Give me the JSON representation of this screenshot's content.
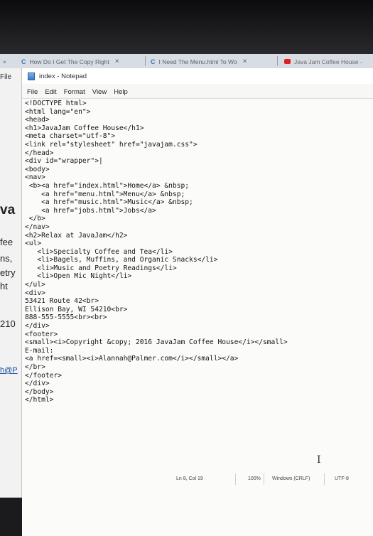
{
  "browser": {
    "tabs": [
      {
        "label": "How Do I Get The Copy Right"
      },
      {
        "label": "I Need The Menu.html To Wo"
      },
      {
        "label": "Java Jam Coffee House -"
      }
    ],
    "tab_close": "×",
    "tab_x_left": "×"
  },
  "background_page": {
    "file_label": "File",
    "fragments": [
      "va",
      "fee",
      "ns,",
      "etry",
      "ht",
      "210",
      "h@P"
    ]
  },
  "notepad": {
    "title": "index - Notepad",
    "menu": [
      "File",
      "Edit",
      "Format",
      "View",
      "Help"
    ],
    "lines": [
      "<!DOCTYPE html>",
      "<html lang=\"en\">",
      "<head>",
      "<h1>JavaJam Coffee House</h1>",
      "<meta charset=\"utf-8\">",
      "<link rel=\"stylesheet\" href=\"javajam.css\">",
      "</head>",
      "<div id=\"wrapper\">|",
      "<body>",
      "<nav>",
      " <b><a href=\"index.html\">Home</a> &nbsp;",
      "    <a href=\"menu.html\">Menu</a> &nbsp;",
      "    <a href=\"music.html\">Music</a> &nbsp;",
      "    <a href=\"jobs.html\">Jobs</a>",
      " </b>",
      "</nav>",
      "<h2>Relax at JavaJam</h2>",
      "<ul>",
      "   <li>Specialty Coffee and Tea</li>",
      "   <li>Bagels, Muffins, and Organic Snacks</li>",
      "   <li>Music and Poetry Readings</li>",
      "   <li>Open Mic Night</li>",
      "</ul>",
      "<div>",
      "53421 Route 42<br>",
      "Ellison Bay, WI 54210<br>",
      "888-555-5555<br><br>",
      "</div>",
      "<footer>",
      "<small><i>Copyright &copy; 2016 JavaJam Coffee House</i></small>",
      "E-mail:",
      "<a href=<small><i>Alannah@Palmer.com</i></small></a>",
      "</br>",
      "</footer>",
      "</div>",
      "</body>",
      "</html>"
    ],
    "status": {
      "position": "Ln 8, Col 19",
      "zoom": "100%",
      "line_ending": "Windows (CRLF)",
      "encoding": "UTF-8"
    }
  }
}
